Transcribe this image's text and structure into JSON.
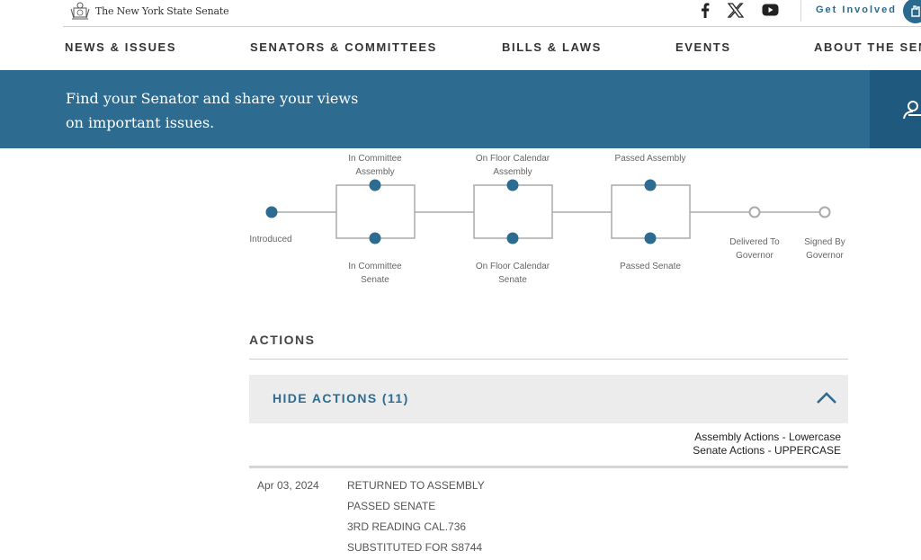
{
  "header": {
    "site_name": "The New York State Senate",
    "get_involved": "Get Involved",
    "social": [
      {
        "icon": "facebook-icon"
      },
      {
        "icon": "x-icon"
      },
      {
        "icon": "youtube-icon"
      }
    ]
  },
  "nav": {
    "items": [
      "NEWS & ISSUES",
      "SENATORS & COMMITTEES",
      "BILLS & LAWS",
      "EVENTS",
      "ABOUT THE SENA"
    ]
  },
  "banner": {
    "text": "Find your Senator and share your views on important issues."
  },
  "timeline": {
    "introduced": "Introduced",
    "committee_assembly": [
      "In Committee",
      "Assembly"
    ],
    "committee_senate": [
      "In Committee",
      "Senate"
    ],
    "floor_assembly": [
      "On Floor Calendar",
      "Assembly"
    ],
    "floor_senate": [
      "On Floor Calendar",
      "Senate"
    ],
    "passed_assembly": "Passed Assembly",
    "passed_senate": "Passed Senate",
    "delivered": [
      "Delivered To",
      "Governor"
    ],
    "signed": [
      "Signed By",
      "Governor"
    ]
  },
  "actions": {
    "title": "ACTIONS",
    "toggle_label": "HIDE ACTIONS (11)",
    "legend_assembly": "Assembly Actions - Lowercase",
    "legend_senate": "Senate Actions - UPPERCASE",
    "entries": [
      {
        "date": "Apr 03, 2024",
        "lines": [
          "RETURNED TO ASSEMBLY",
          "PASSED SENATE",
          "3RD READING CAL.736",
          "SUBSTITUTED FOR S8744"
        ]
      }
    ]
  },
  "colors": {
    "brand_blue": "#2d6b91",
    "banner_dark": "#1f5a7e",
    "incomplete_step": "#aaaaaa"
  }
}
